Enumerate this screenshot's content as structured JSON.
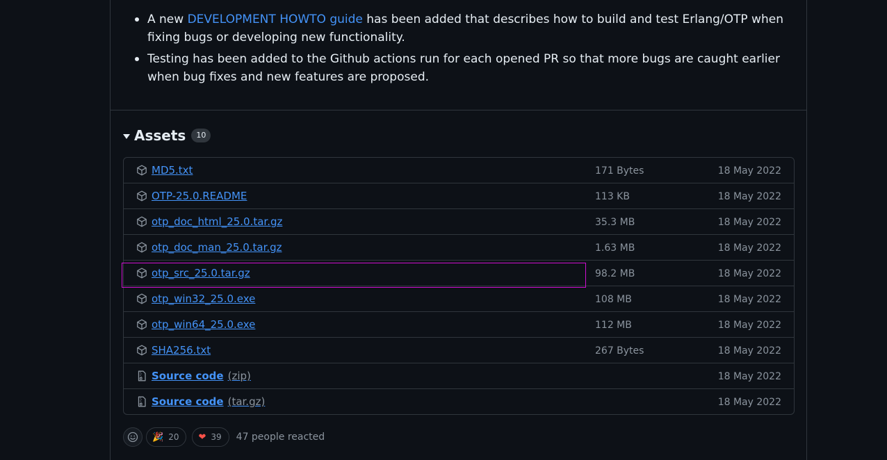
{
  "notes": {
    "item1_prefix": "A new ",
    "item1_link": "DEVELOPMENT HOWTO guide",
    "item1_suffix": " has been added that describes how to build and test Erlang/OTP when fixing bugs or developing new functionality.",
    "item2": "Testing has been added to the Github actions run for each opened PR so that more bugs are caught earlier when bug fixes and new features are proposed."
  },
  "assets": {
    "title": "Assets",
    "count": "10",
    "items": [
      {
        "name": "MD5.txt",
        "size": "171 Bytes",
        "date": "18 May 2022",
        "icon": "package-icon"
      },
      {
        "name": "OTP-25.0.README",
        "size": "113 KB",
        "date": "18 May 2022",
        "icon": "package-icon"
      },
      {
        "name": "otp_doc_html_25.0.tar.gz",
        "size": "35.3 MB",
        "date": "18 May 2022",
        "icon": "package-icon"
      },
      {
        "name": "otp_doc_man_25.0.tar.gz",
        "size": "1.63 MB",
        "date": "18 May 2022",
        "icon": "package-icon"
      },
      {
        "name": "otp_src_25.0.tar.gz",
        "size": "98.2 MB",
        "date": "18 May 2022",
        "icon": "package-icon"
      },
      {
        "name": "otp_win32_25.0.exe",
        "size": "108 MB",
        "date": "18 May 2022",
        "icon": "package-icon"
      },
      {
        "name": "otp_win64_25.0.exe",
        "size": "112 MB",
        "date": "18 May 2022",
        "icon": "package-icon"
      },
      {
        "name": "SHA256.txt",
        "size": "267 Bytes",
        "date": "18 May 2022",
        "icon": "package-icon"
      }
    ],
    "source": [
      {
        "name": "Source code",
        "format": "(zip)",
        "date": "18 May 2022",
        "icon": "file-zip-icon"
      },
      {
        "name": "Source code",
        "format": "(tar.gz)",
        "date": "18 May 2022",
        "icon": "file-zip-icon"
      }
    ]
  },
  "reactions": {
    "tada_emoji": "🎉",
    "tada_count": "20",
    "heart_emoji": "❤",
    "heart_count": "39",
    "summary": "47 people reacted"
  },
  "colors": {
    "background": "#0d1117",
    "link": "#4493f8",
    "muted": "#8b949e",
    "border": "#30363d",
    "highlight": "#d20fd2",
    "heart": "#f85149"
  }
}
